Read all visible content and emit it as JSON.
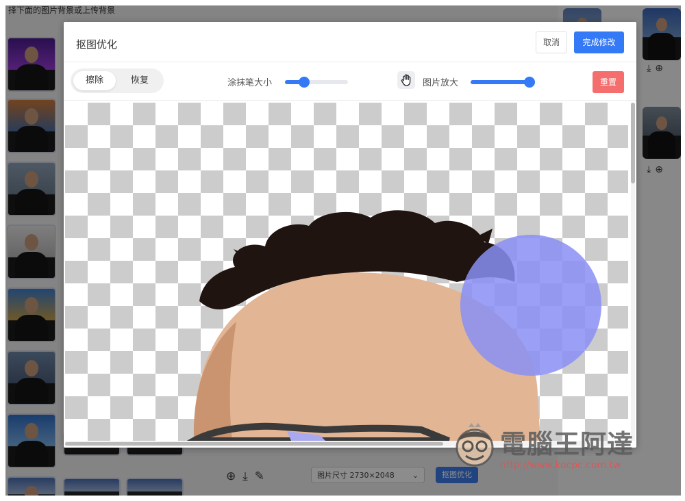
{
  "background": {
    "top_text": "择下面的图片背景或上传背景",
    "size_select": "图片尺寸 2730×2048",
    "optimize_label": "抠图优化"
  },
  "modal": {
    "title": "抠图优化",
    "cancel_label": "取消",
    "done_label": "完成修改",
    "mode": {
      "erase_label": "擦除",
      "restore_label": "恢复",
      "active": "erase"
    },
    "brush_size_label": "涂抹笔大小",
    "brush_size_value": 0.3,
    "zoom_label": "图片放大",
    "zoom_value": 0.98,
    "reset_label": "重置"
  },
  "watermark": {
    "title": "電腦王阿達",
    "url": "http://www.kocpc.com.tw"
  },
  "colors": {
    "primary": "#3479f6",
    "danger": "#f46e6e",
    "brush_cursor": "#8a8ff5"
  },
  "icons": [
    "hand-icon",
    "zoom-in-icon",
    "download-icon",
    "edit-icon",
    "chevron-down-icon"
  ]
}
